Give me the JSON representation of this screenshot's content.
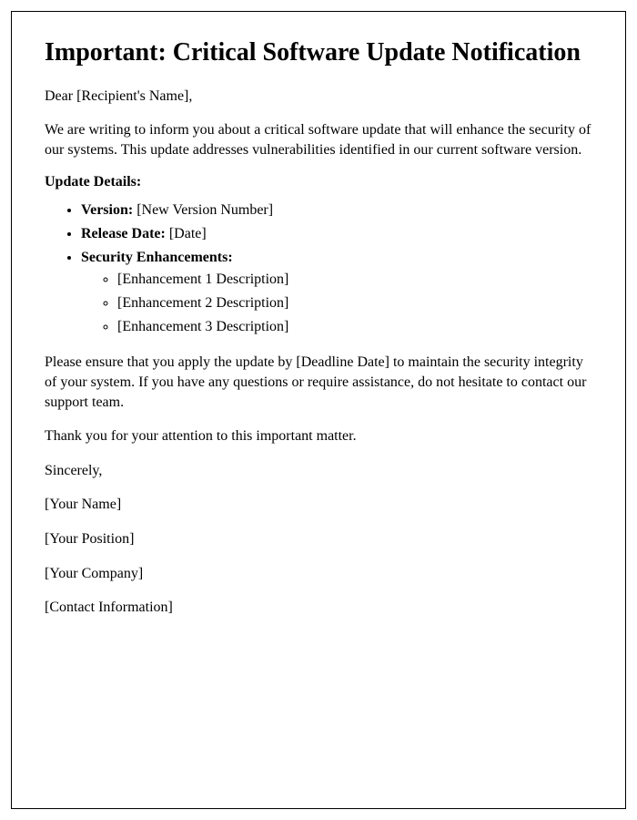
{
  "title": "Important: Critical Software Update Notification",
  "greeting": "Dear [Recipient's Name],",
  "intro": "We are writing to inform you about a critical software update that will enhance the security of our systems. This update addresses vulnerabilities identified in our current software version.",
  "details_label": "Update Details:",
  "details": {
    "version_label": "Version:",
    "version_value": " [New Version Number]",
    "release_label": "Release Date:",
    "release_value": " [Date]",
    "security_label": "Security Enhancements:",
    "enhancements": {
      "e1": "[Enhancement 1 Description]",
      "e2": "[Enhancement 2 Description]",
      "e3": "[Enhancement 3 Description]"
    }
  },
  "deadline_text": "Please ensure that you apply the update by [Deadline Date] to maintain the security integrity of your system. If you have any questions or require assistance, do not hesitate to contact our support team.",
  "thanks": "Thank you for your attention to this important matter.",
  "closing": "Sincerely,",
  "signature": {
    "name": "[Your Name]",
    "position": "[Your Position]",
    "company": "[Your Company]",
    "contact": "[Contact Information]"
  }
}
